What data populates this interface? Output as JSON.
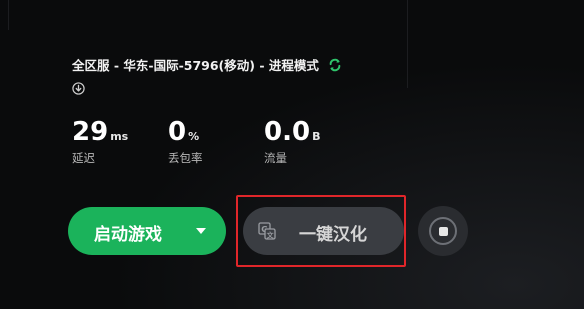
{
  "server": {
    "info": "全区服 - 华东-国际-5796(移动) - 进程模式",
    "sync_icon": "sync-arrows-icon",
    "expand_icon": "circle-down-arrow-icon"
  },
  "stats": {
    "latency": {
      "value": "29",
      "unit": "ms",
      "label": "延迟"
    },
    "packet_loss": {
      "value": "0",
      "unit": "%",
      "label": "丢包率"
    },
    "traffic": {
      "value": "0.0",
      "unit": "B",
      "label": "流量"
    }
  },
  "actions": {
    "launch_label": "启动游戏",
    "translate_label": "一键汉化",
    "translate_icon": "translate-icon",
    "stop_icon": "stop-icon"
  },
  "colors": {
    "accent_green": "#1bb35b",
    "highlight_red": "#e0262a",
    "background": "#0a0b0c"
  }
}
